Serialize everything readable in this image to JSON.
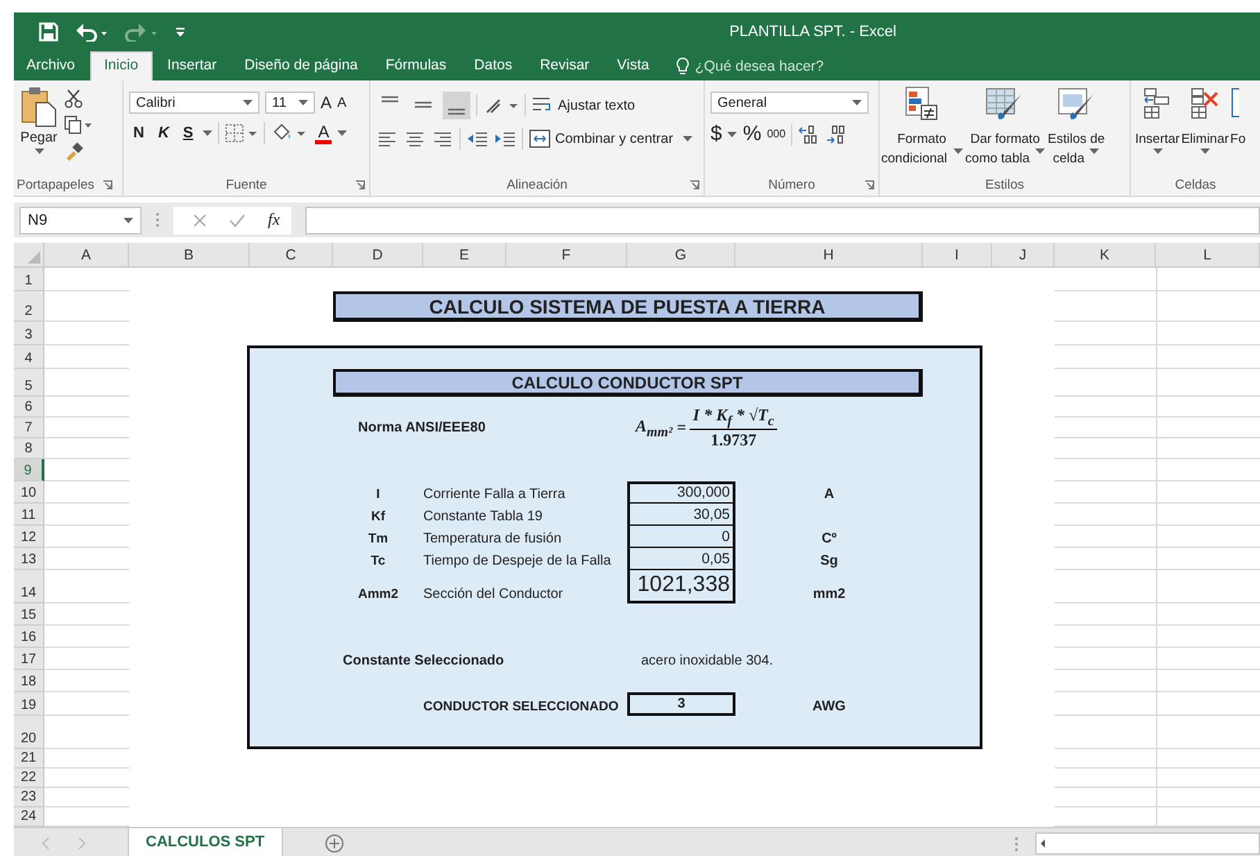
{
  "window": {
    "title": "PLANTILLA SPT. - Excel"
  },
  "quick_access": [
    {
      "kind": "save",
      "disabled": false
    },
    {
      "kind": "undo",
      "disabled": false
    },
    {
      "kind": "redo",
      "disabled": true
    },
    {
      "kind": "customize",
      "disabled": false
    }
  ],
  "tabs": [
    {
      "label": "Archivo",
      "selected": false
    },
    {
      "label": "Inicio",
      "selected": true
    },
    {
      "label": "Insertar",
      "selected": false
    },
    {
      "label": "Diseño de página",
      "selected": false
    },
    {
      "label": "Fórmulas",
      "selected": false
    },
    {
      "label": "Datos",
      "selected": false
    },
    {
      "label": "Revisar",
      "selected": false
    },
    {
      "label": "Vista",
      "selected": false
    }
  ],
  "tell_me": {
    "placeholder": "¿Qué desea hacer?"
  },
  "ribbon": {
    "clipboard": {
      "label": "Portapapeles",
      "paste": "Pegar"
    },
    "font": {
      "label": "Fuente",
      "font_name": "Calibri",
      "font_size": "11",
      "grow": "A",
      "shrink": "A",
      "bold": "N",
      "italic": "K",
      "underline": "S",
      "font_color": "A"
    },
    "alignment": {
      "label": "Alineación",
      "wrap": "Ajustar texto",
      "merge": "Combinar y centrar",
      "vertical_align": [
        {
          "selected": false
        },
        {
          "selected": false
        },
        {
          "selected": true
        }
      ]
    },
    "number": {
      "label": "Número",
      "format": "General",
      "currency": "$",
      "percent": "%",
      "thousands": "000"
    },
    "styles": {
      "label": "Estilos",
      "buttons": [
        {
          "kind": "conditional",
          "line1": "Formato",
          "line2": "condicional"
        },
        {
          "kind": "table",
          "line1": "Dar formato",
          "line2": "como tabla"
        },
        {
          "kind": "cell",
          "line1": "Estilos de",
          "line2": "celda"
        }
      ]
    },
    "cells": {
      "label": "Celdas",
      "buttons": [
        {
          "kind": "insert",
          "label": "Insertar"
        },
        {
          "kind": "delete",
          "label": "Eliminar"
        },
        {
          "kind": "format",
          "label": "Fo"
        }
      ]
    }
  },
  "formula_bar": {
    "name_box": "N9",
    "fx": "fx"
  },
  "columns": [
    "A",
    "B",
    "C",
    "D",
    "E",
    "F",
    "G",
    "H",
    "I",
    "J",
    "K",
    "L"
  ],
  "rows": [
    {
      "label": "1",
      "selected": false
    },
    {
      "label": "2",
      "selected": false
    },
    {
      "label": "3",
      "selected": false
    },
    {
      "label": "4",
      "selected": false
    },
    {
      "label": "5",
      "selected": false
    },
    {
      "label": "6",
      "selected": false
    },
    {
      "label": "7",
      "selected": false
    },
    {
      "label": "8",
      "selected": false
    },
    {
      "label": "9",
      "selected": true
    },
    {
      "label": "10",
      "selected": false
    },
    {
      "label": "11",
      "selected": false
    },
    {
      "label": "12",
      "selected": false
    },
    {
      "label": "13",
      "selected": false
    },
    {
      "label": "14",
      "selected": false
    },
    {
      "label": "15",
      "selected": false
    },
    {
      "label": "16",
      "selected": false
    },
    {
      "label": "17",
      "selected": false
    },
    {
      "label": "18",
      "selected": false
    },
    {
      "label": "19",
      "selected": false
    },
    {
      "label": "20",
      "selected": false
    },
    {
      "label": "21",
      "selected": false
    },
    {
      "label": "22",
      "selected": false
    },
    {
      "label": "23",
      "selected": false
    },
    {
      "label": "24",
      "selected": false
    }
  ],
  "sheet": {
    "title": "CALCULO SISTEMA DE PUESTA A TIERRA",
    "panel_title": "CALCULO CONDUCTOR SPT",
    "norm": "Norma ANSI/EEE80",
    "formula": {
      "lhs": "A$_{mm²}$",
      "equals": "=",
      "numerator": "I * K$_{f}$ * √T$_{c}$",
      "denominator": "1.9737"
    },
    "inputs": [
      {
        "kind": "input",
        "symbol": "I",
        "label": "Corriente Falla a Tierra",
        "value": "300,000",
        "unit": "A"
      },
      {
        "kind": "input",
        "symbol": "Kf",
        "label": "Constante Tabla 19",
        "value": "30,05"
      },
      {
        "kind": "input",
        "symbol": "Tm",
        "label": "Temperatura de fusión",
        "value": "0",
        "unit": "Cº"
      },
      {
        "kind": "input",
        "symbol": "Tc",
        "label": "Tiempo de Despeje de la Falla",
        "value": "0,05",
        "unit": "Sg"
      },
      {
        "kind": "result",
        "symbol": "Amm2",
        "label": "Sección del Conductor",
        "value": "1021,338",
        "unit": "mm2"
      }
    ],
    "constant": {
      "label": "Constante  Seleccionado",
      "value": "acero inoxidable 304."
    },
    "conductor": {
      "label": "CONDUCTOR SELECCIONADO",
      "value": "3",
      "unit": "AWG"
    }
  },
  "sheet_tabs": [
    {
      "label": "CALCULOS SPT",
      "selected": true
    }
  ]
}
